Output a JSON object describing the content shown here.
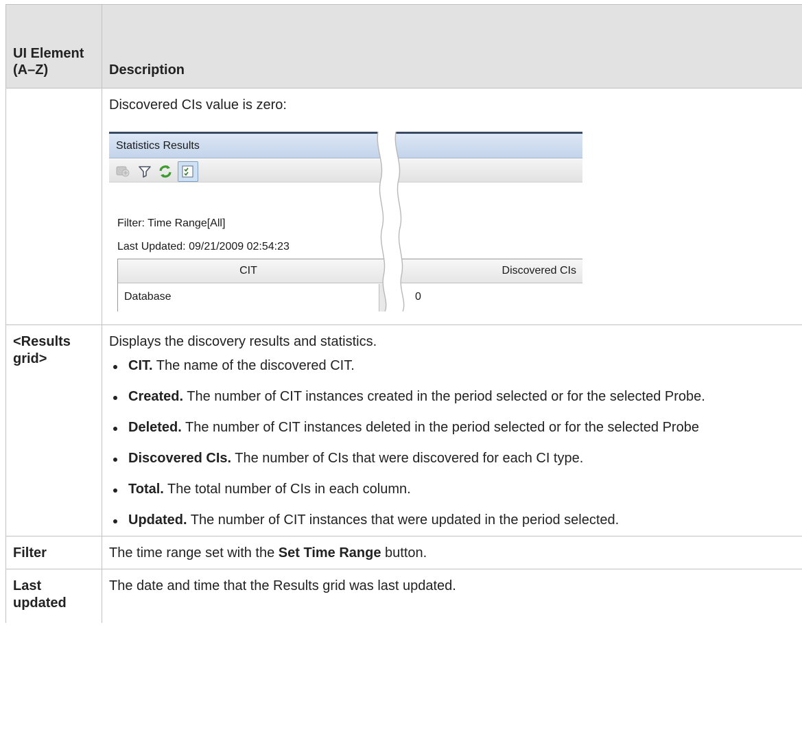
{
  "header": {
    "col1": "UI Element (A–Z)",
    "col2": "Description"
  },
  "rows": [
    {
      "term": "",
      "intro": "Discovered CIs value is zero:",
      "screenshot": {
        "title": "Statistics Results",
        "toolbar_icons": [
          "probe-icon",
          "filter-icon",
          "refresh-icon",
          "select-columns-icon"
        ],
        "filter_text": "Filter: Time Range[All]",
        "last_updated_text": "Last Updated: 09/21/2009 02:54:23",
        "columns": [
          "CIT",
          "Discovered CIs"
        ],
        "row": {
          "cit": "Database",
          "discovered": "0"
        }
      }
    },
    {
      "term": "<Results grid>",
      "intro": "Displays the discovery results and statistics.",
      "bullets": [
        {
          "bold": "CIT.",
          "text": " The name of the discovered CIT."
        },
        {
          "bold": "Created.",
          "text": " The number of CIT instances created in the period selected or for the selected Probe."
        },
        {
          "bold": "Deleted.",
          "text": " The number of CIT instances deleted in the period selected or for the selected Probe"
        },
        {
          "bold": "Discovered CIs.",
          "text": " The number of CIs that were discovered for each CI type."
        },
        {
          "bold": "Total.",
          "text": " The total number of CIs in each column."
        },
        {
          "bold": "Updated.",
          "text": " The number of CIT instances that were updated in the period selected."
        }
      ]
    },
    {
      "term": "Filter",
      "pre": "The time range set with the ",
      "bold": "Set Time Range",
      "post": " button."
    },
    {
      "term": "Last updated",
      "text": "The date and time that the Results grid was last updated."
    }
  ]
}
